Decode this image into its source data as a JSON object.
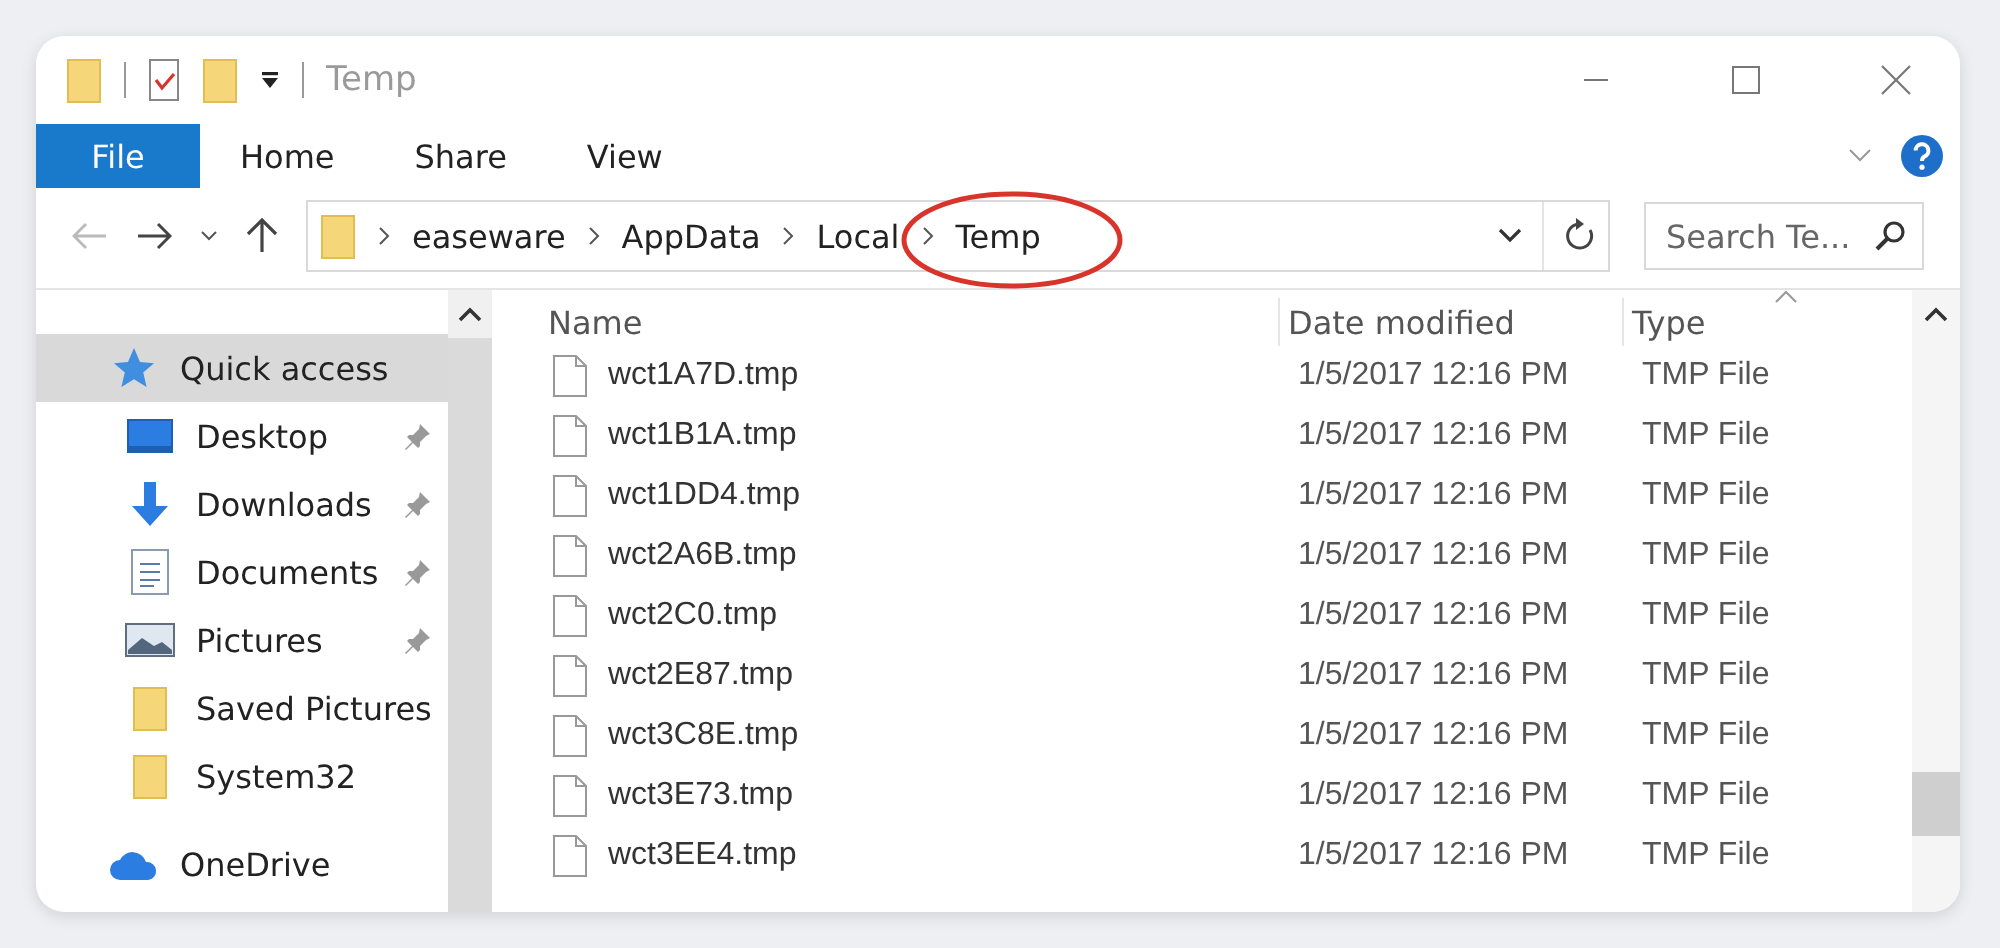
{
  "window": {
    "title": "Temp"
  },
  "quick_access_toolbar": [
    {
      "kind": "folder"
    },
    {
      "kind": "properties"
    },
    {
      "kind": "new-folder"
    },
    {
      "kind": "customize"
    }
  ],
  "ribbon": {
    "tabs": [
      {
        "label": "File",
        "kind": "file",
        "selected": false
      },
      {
        "label": "Home",
        "kind": "tab",
        "selected": false
      },
      {
        "label": "Share",
        "kind": "tab",
        "selected": false
      },
      {
        "label": "View",
        "kind": "tab",
        "selected": false
      }
    ]
  },
  "address_bar": {
    "back_disabled": true,
    "forward_disabled": false,
    "breadcrumbs": [
      {
        "label": "easeware",
        "highlighted": false
      },
      {
        "label": "AppData",
        "highlighted": false
      },
      {
        "label": "Local",
        "highlighted": false
      },
      {
        "label": "Temp",
        "highlighted": true
      }
    ],
    "search": {
      "placeholder": "Search Te..."
    }
  },
  "sidebar": {
    "items": [
      {
        "label": "Quick access",
        "kind": "star",
        "selected": true,
        "pinned": false,
        "children": [
          {
            "label": "Desktop",
            "kind": "desktop",
            "selected": false,
            "pinned": true
          },
          {
            "label": "Downloads",
            "kind": "download",
            "selected": false,
            "pinned": true
          },
          {
            "label": "Documents",
            "kind": "document",
            "selected": false,
            "pinned": true
          },
          {
            "label": "Pictures",
            "kind": "pictures",
            "selected": false,
            "pinned": true
          },
          {
            "label": "Saved Pictures",
            "kind": "folder",
            "selected": false,
            "pinned": false
          },
          {
            "label": "System32",
            "kind": "folder",
            "selected": false,
            "pinned": false
          }
        ]
      },
      {
        "label": "OneDrive",
        "kind": "cloud",
        "selected": false,
        "pinned": false
      }
    ]
  },
  "table": {
    "columns": [
      {
        "label": "Name",
        "sorted": false
      },
      {
        "label": "Date modified",
        "sorted": false
      },
      {
        "label": "Type",
        "sorted": true
      }
    ],
    "rows": [
      {
        "name": "wct1A7D.tmp",
        "date": "1/5/2017 12:16 PM",
        "type": "TMP File"
      },
      {
        "name": "wct1B1A.tmp",
        "date": "1/5/2017 12:16 PM",
        "type": "TMP File"
      },
      {
        "name": "wct1DD4.tmp",
        "date": "1/5/2017 12:16 PM",
        "type": "TMP File"
      },
      {
        "name": "wct2A6B.tmp",
        "date": "1/5/2017 12:16 PM",
        "type": "TMP File"
      },
      {
        "name": "wct2C0.tmp",
        "date": "1/5/2017 12:16 PM",
        "type": "TMP File"
      },
      {
        "name": "wct2E87.tmp",
        "date": "1/5/2017 12:16 PM",
        "type": "TMP File"
      },
      {
        "name": "wct3C8E.tmp",
        "date": "1/5/2017 12:16 PM",
        "type": "TMP File"
      },
      {
        "name": "wct3E73.tmp",
        "date": "1/5/2017 12:16 PM",
        "type": "TMP File"
      },
      {
        "name": "wct3EE4.tmp",
        "date": "1/5/2017 12:16 PM",
        "type": "TMP File"
      }
    ]
  }
}
